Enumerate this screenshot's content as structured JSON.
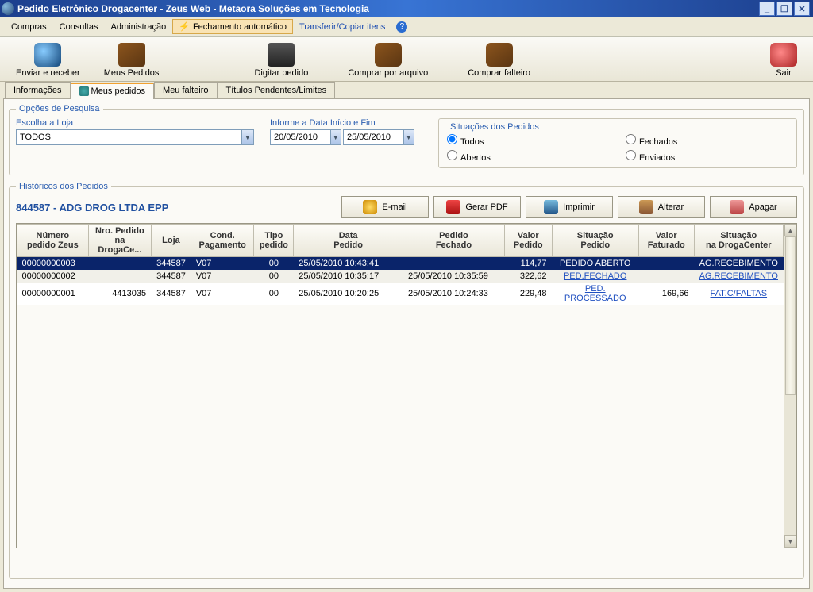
{
  "window": {
    "title": "Pedido Eletrônico Drogacenter - Zeus Web - Metaora Soluções em Tecnologia"
  },
  "menu": {
    "compras": "Compras",
    "consultas": "Consultas",
    "administracao": "Administração",
    "fechamento": "Fechamento automático",
    "transferir": "Transferir/Copiar itens"
  },
  "toolbar": {
    "enviar": "Enviar e receber",
    "meus": "Meus Pedidos",
    "digitar": "Digitar pedido",
    "arquivo": "Comprar por arquivo",
    "falteiro": "Comprar falteiro",
    "sair": "Sair"
  },
  "tabs": {
    "info": "Informações",
    "meus": "Meus pedidos",
    "falteiro": "Meu falteiro",
    "titulos": "Títulos Pendentes/Limites"
  },
  "search": {
    "legend": "Opções de Pesquisa",
    "escolha": "Escolha a Loja",
    "loja_value": "TODOS",
    "data_label": "Informe a Data Início e Fim",
    "data_ini": "20/05/2010",
    "data_fim": "25/05/2010",
    "situacoes_label": "Situações dos Pedidos",
    "r_todos": "Todos",
    "r_abertos": "Abertos",
    "r_fechados": "Fechados",
    "r_enviados": "Enviados"
  },
  "hist": {
    "legend": "Históricos dos Pedidos",
    "customer": "844587 - ADG DROG LTDA EPP",
    "btn_email": "E-mail",
    "btn_pdf": "Gerar PDF",
    "btn_print": "Imprimir",
    "btn_edit": "Alterar",
    "btn_del": "Apagar"
  },
  "cols": {
    "c1a": "Número",
    "c1b": "pedido Zeus",
    "c2a": "Nro. Pedido",
    "c2b": "na DrogaCe...",
    "c3": "Loja",
    "c4a": "Cond.",
    "c4b": "Pagamento",
    "c5a": "Tipo",
    "c5b": "pedido",
    "c6a": "Data",
    "c6b": "Pedido",
    "c7a": "Pedido",
    "c7b": "Fechado",
    "c8a": "Valor",
    "c8b": "Pedido",
    "c9a": "Situação",
    "c9b": "Pedido",
    "c10a": "Valor",
    "c10b": "Faturado",
    "c11a": "Situação",
    "c11b": "na DrogaCenter"
  },
  "rows": [
    {
      "zeus": "00000000003",
      "droga": "",
      "loja": "344587",
      "cond": "V07",
      "tipo": "00",
      "data": "25/05/2010 10:43:41",
      "fechado": "",
      "valor": "114,77",
      "sit": "PEDIDO ABERTO",
      "fat": "",
      "sitdc": "AG.RECEBIMENTO",
      "sel": true
    },
    {
      "zeus": "00000000002",
      "droga": "",
      "loja": "344587",
      "cond": "V07",
      "tipo": "00",
      "data": "25/05/2010 10:35:17",
      "fechado": "25/05/2010 10:35:59",
      "valor": "322,62",
      "sit": "PED.FECHADO",
      "fat": "",
      "sitdc": "AG.RECEBIMENTO",
      "sel": false
    },
    {
      "zeus": "00000000001",
      "droga": "4413035",
      "loja": "344587",
      "cond": "V07",
      "tipo": "00",
      "data": "25/05/2010 10:20:25",
      "fechado": "25/05/2010 10:24:33",
      "valor": "229,48",
      "sit": "PED. PROCESSADO",
      "fat": "169,66",
      "sitdc": "FAT.C/FALTAS",
      "sel": false
    }
  ]
}
